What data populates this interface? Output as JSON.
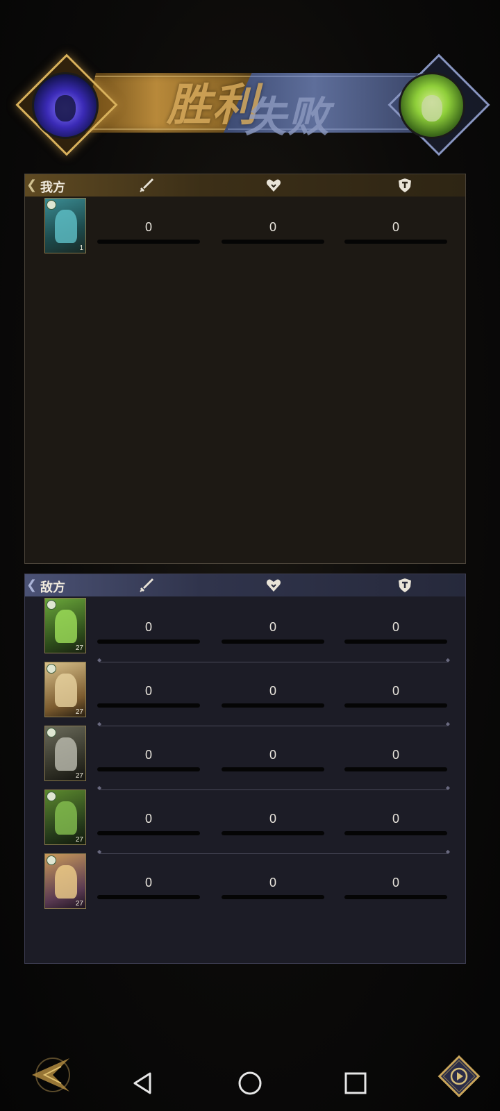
{
  "banner": {
    "win_text": "胜利",
    "lose_text": "失败",
    "left_avatar_icon": "hooded-mage-portrait",
    "right_avatar_icon": "green-haired-queen-portrait"
  },
  "columns": {
    "damage_icon": "sword-icon",
    "heal_icon": "heart-icon",
    "shield_icon": "shield-icon"
  },
  "my_team": {
    "label": "我方",
    "rows": [
      {
        "portrait": "blue-haired-hero",
        "level": "1",
        "damage": "0",
        "heal": "0",
        "shield": "0",
        "color": "#2f7f88"
      }
    ]
  },
  "enemy_team": {
    "label": "敌方",
    "rows": [
      {
        "portrait": "green-haired-queen",
        "level": "27",
        "damage": "0",
        "heal": "0",
        "shield": "0",
        "color": "#7fc33f"
      },
      {
        "portrait": "furry-beast",
        "level": "27",
        "damage": "0",
        "heal": "0",
        "shield": "0",
        "color": "#c7a66e"
      },
      {
        "portrait": "grey-haired-warrior",
        "level": "27",
        "damage": "0",
        "heal": "0",
        "shield": "0",
        "color": "#7a7a68"
      },
      {
        "portrait": "leafy-monster",
        "level": "27",
        "damage": "0",
        "heal": "0",
        "shield": "0",
        "color": "#5e8a2e"
      },
      {
        "portrait": "blonde-archer",
        "level": "27",
        "damage": "0",
        "heal": "0",
        "shield": "0",
        "color": "#c99a5a"
      }
    ]
  },
  "nav": {
    "back_icon": "gold-arrow-back-icon",
    "replay_icon": "replay-icon",
    "system_back_icon": "triangle-back-icon",
    "system_home_icon": "circle-home-icon",
    "system_recents_icon": "square-recents-icon"
  },
  "colors": {
    "gold": "#d8b15c",
    "blue": "#8895c0",
    "my_panel": "#1d1914",
    "enemy_panel": "#1c1c26"
  }
}
